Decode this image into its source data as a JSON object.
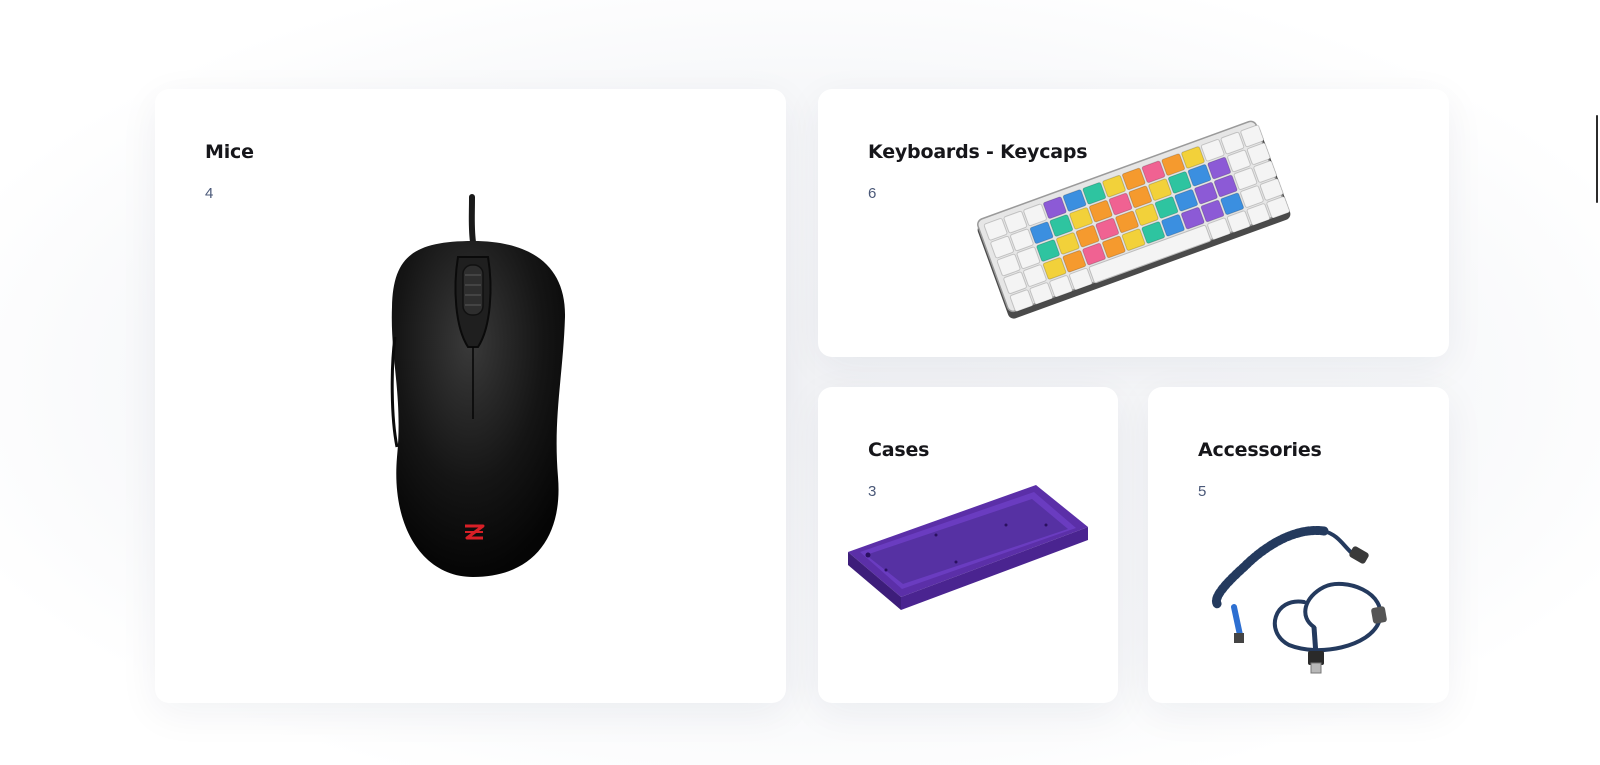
{
  "categories": [
    {
      "name": "Mice",
      "count": "4",
      "image_icon": "mouse-icon"
    },
    {
      "name": "Keyboards - Keycaps",
      "count": "6",
      "image_icon": "keyboard-icon"
    },
    {
      "name": "Cases",
      "count": "3",
      "image_icon": "case-icon"
    },
    {
      "name": "Accessories",
      "count": "5",
      "image_icon": "cable-icon"
    }
  ],
  "colors": {
    "title": "#16161a",
    "count": "#4a5878",
    "card_bg": "#ffffff",
    "case_purple": "#5b2fa8",
    "cable_blue": "#243a5e"
  }
}
